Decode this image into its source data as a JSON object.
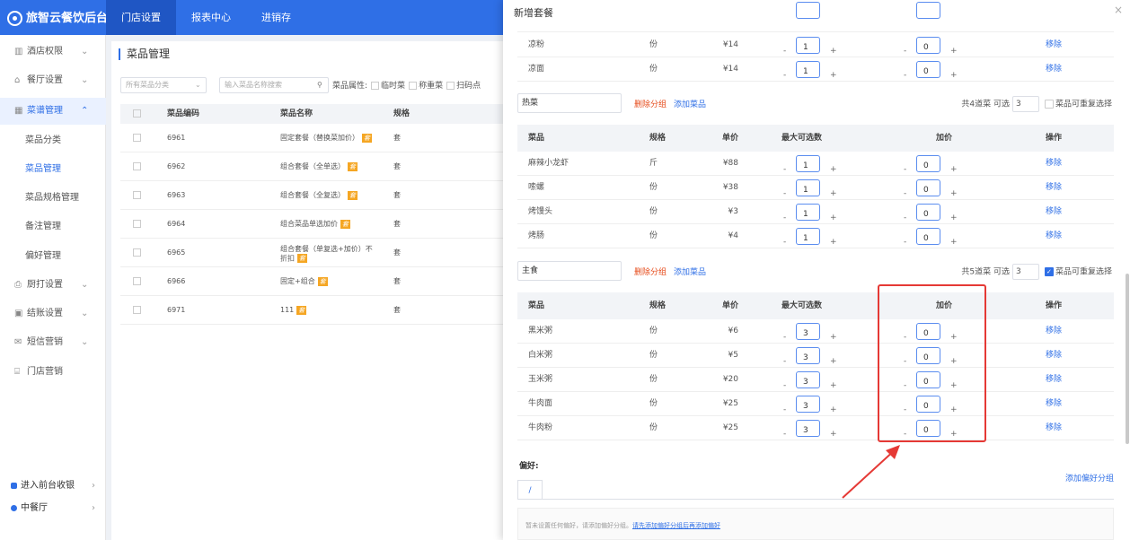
{
  "brand": "旅智云餐饮后台",
  "topnav": [
    "门店设置",
    "报表中心",
    "进销存"
  ],
  "sidebar": {
    "items": [
      {
        "icon": "building-icon",
        "label": "酒店权限"
      },
      {
        "icon": "home-icon",
        "label": "餐厅设置"
      },
      {
        "icon": "grid-icon",
        "label": "菜谱管理"
      }
    ],
    "subitems": [
      "菜品分类",
      "菜品管理",
      "菜品规格管理",
      "备注管理",
      "偏好管理"
    ],
    "items2": [
      {
        "icon": "printer-icon",
        "label": "厨打设置"
      },
      {
        "icon": "receipt-icon",
        "label": "结账设置"
      },
      {
        "icon": "message-icon",
        "label": "短信营销"
      },
      {
        "icon": "store-icon",
        "label": "门店营销"
      }
    ],
    "footer": [
      {
        "label": "进入前台收银"
      },
      {
        "label": "中餐厅"
      }
    ]
  },
  "main": {
    "title": "菜品管理",
    "filter_category": "所有菜品分类",
    "search_placeholder": "输入菜品名称搜索",
    "attr_label": "菜品属性:",
    "attrs": [
      "临时菜",
      "称重菜",
      "扫码点"
    ],
    "headers": {
      "code": "菜品编码",
      "name": "菜品名称",
      "spec": "规格"
    },
    "rows": [
      {
        "code": "6961",
        "name": "固定套餐（替换菜加价）",
        "tag": "套",
        "spec": "套"
      },
      {
        "code": "6962",
        "name": "组合套餐（全单选）",
        "tag": "套",
        "spec": "套"
      },
      {
        "code": "6963",
        "name": "组合套餐（全复选）",
        "tag": "套",
        "spec": "套"
      },
      {
        "code": "6964",
        "name": "组合菜品单选加价",
        "tag": "套",
        "spec": "套"
      },
      {
        "code": "6965",
        "name": "组合套餐（单复选+加价）不",
        "name2": "折扣",
        "tag": "套",
        "spec": "套"
      },
      {
        "code": "6966",
        "name": "固定+组合",
        "tag": "套",
        "spec": "套"
      },
      {
        "code": "6971",
        "name": "111",
        "tag": "套",
        "spec": "套"
      }
    ]
  },
  "drawer": {
    "title": "新增套餐",
    "table_headers": {
      "dish": "菜品",
      "spec": "规格",
      "price": "单价",
      "max": "最大可选数",
      "extra": "加价",
      "op": "操作"
    },
    "remove_label": "移除",
    "delete_group": "删除分组",
    "add_dish": "添加菜品",
    "optional_label": "可选",
    "repeat_label": "菜品可重复选择",
    "top_rows": [
      {
        "dish": "凉粉",
        "spec": "份",
        "price": "¥14",
        "max": "1",
        "extra": "0"
      },
      {
        "dish": "凉面",
        "spec": "份",
        "price": "¥14",
        "max": "1",
        "extra": "0"
      }
    ],
    "groups": [
      {
        "name": "热菜",
        "count_text": "共4道菜",
        "optional": "3",
        "repeat": false,
        "rows": [
          {
            "dish": "麻辣小龙虾",
            "spec": "斤",
            "price": "¥88",
            "max": "1",
            "extra": "0"
          },
          {
            "dish": "嗦螺",
            "spec": "份",
            "price": "¥38",
            "max": "1",
            "extra": "0"
          },
          {
            "dish": "烤馒头",
            "spec": "份",
            "price": "¥3",
            "max": "1",
            "extra": "0"
          },
          {
            "dish": "烤肠",
            "spec": "份",
            "price": "¥4",
            "max": "1",
            "extra": "0"
          }
        ]
      },
      {
        "name": "主食",
        "count_text": "共5道菜",
        "optional": "3",
        "repeat": true,
        "rows": [
          {
            "dish": "黑米粥",
            "spec": "份",
            "price": "¥6",
            "max": "3",
            "extra": "0"
          },
          {
            "dish": "白米粥",
            "spec": "份",
            "price": "¥5",
            "max": "3",
            "extra": "0"
          },
          {
            "dish": "玉米粥",
            "spec": "份",
            "price": "¥20",
            "max": "3",
            "extra": "0"
          },
          {
            "dish": "牛肉面",
            "spec": "份",
            "price": "¥25",
            "max": "3",
            "extra": "0"
          },
          {
            "dish": "牛肉粉",
            "spec": "份",
            "price": "¥25",
            "max": "3",
            "extra": "0"
          }
        ]
      }
    ],
    "pref_label": "偏好:",
    "add_pref_group": "添加偏好分组",
    "pref_tab": "/",
    "pref_empty": "暂未设置任何偏好，请添加偏好分组。",
    "pref_link": "请先添加偏好分组后再添加偏好"
  },
  "colors": {
    "primary": "#2f6fe6",
    "danger": "#e53935",
    "tag": "#f5a623"
  }
}
